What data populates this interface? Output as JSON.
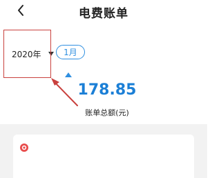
{
  "header": {
    "title": "电费账单",
    "back_icon": "chevron-left-icon"
  },
  "filters": {
    "year": "2020年",
    "year_icon": "caret-down-icon",
    "month": "1月"
  },
  "summary": {
    "amount": "178.85",
    "amount_label": "账单总额(元)"
  },
  "card": {
    "icon": "target-icon"
  },
  "colors": {
    "accent_blue": "#2f8fe0",
    "amount_blue": "#1b7fd6",
    "annotation_red": "#c9413e",
    "card_icon_red": "#e84b4b",
    "background_gray": "#f2f2f2"
  }
}
